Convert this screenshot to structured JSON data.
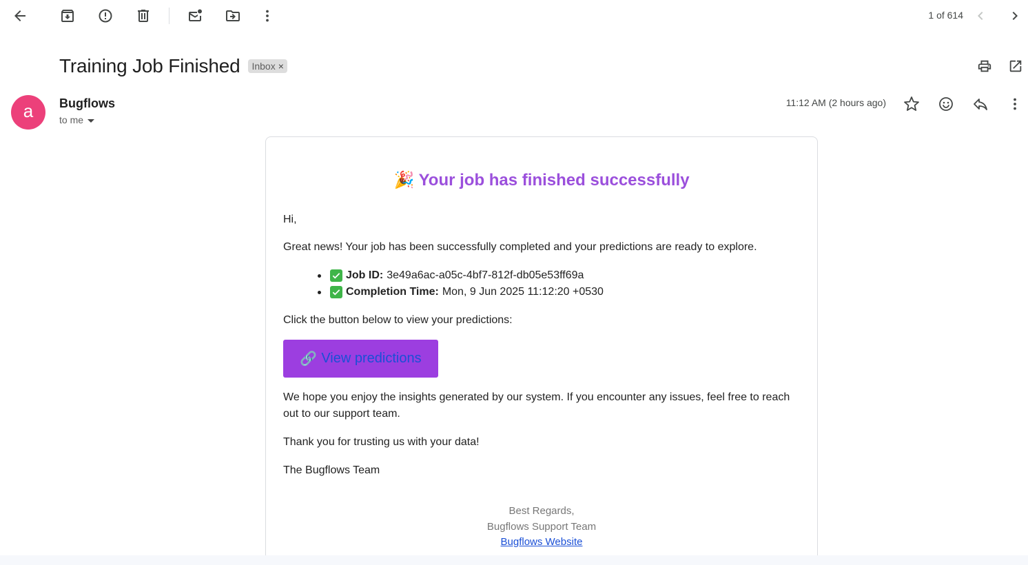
{
  "toolbar": {
    "icons": [
      "back-arrow-icon",
      "archive-icon",
      "report-spam-icon",
      "delete-icon",
      "mark-unread-icon",
      "move-to-icon",
      "more-vert-icon"
    ],
    "pager": "1 of 614"
  },
  "header": {
    "subject": "Training Job Finished",
    "label": "Inbox",
    "label_remove": "×"
  },
  "message": {
    "avatar_letter": "a",
    "avatar_color": "#ec407a",
    "sender": "Bugflows",
    "recipient": "to me",
    "date": "11:12 AM (2 hours ago)"
  },
  "email": {
    "title_emoji": "🎉",
    "title": "Your job has finished successfully",
    "title_color": "#9b4fdc",
    "greeting": "Hi,",
    "intro": "Great news! Your job has been successfully completed and your predictions are ready to explore.",
    "details": [
      {
        "label": "Job ID:",
        "value": "3e49a6ac-a05c-4bf7-812f-db05e53ff69a"
      },
      {
        "label": "Completion Time:",
        "value": "Mon, 9 Jun 2025 11:12:20 +0530"
      }
    ],
    "cta_prompt": "Click the button below to view your predictions:",
    "cta_icon": "🔗",
    "cta_label": "View predictions",
    "cta_color": "#9c3ee0",
    "body_line1": "We hope you enjoy the insights generated by our system. If you encounter any issues, feel free to reach",
    "body_line2": "out to our support team.",
    "thanks": "Thank you for trusting us with your data!",
    "signoff": "The Bugflows Team",
    "footer_regards": "Best Regards,",
    "footer_team": "Bugflows Support Team",
    "footer_link": "Bugflows Website"
  }
}
